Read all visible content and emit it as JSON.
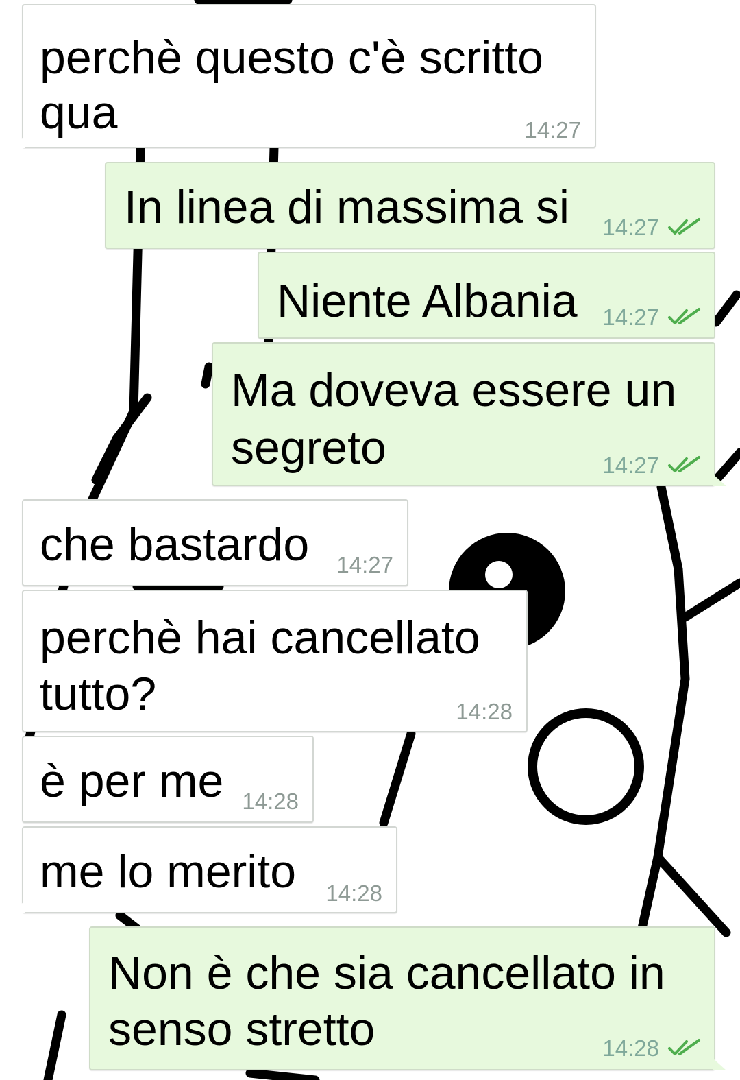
{
  "messages": [
    {
      "direction": "in",
      "lines": [
        "perchè questo c'è scritto",
        "qua"
      ],
      "time": "14:27"
    },
    {
      "direction": "out",
      "lines": [
        "In linea di massima si"
      ],
      "time": "14:27",
      "status_icon": "double-check-icon"
    },
    {
      "direction": "out",
      "lines": [
        "Niente Albania"
      ],
      "time": "14:27",
      "status_icon": "double-check-icon"
    },
    {
      "direction": "out",
      "lines": [
        "Ma doveva essere un",
        "segreto"
      ],
      "time": "14:27",
      "status_icon": "double-check-icon"
    },
    {
      "direction": "in",
      "lines": [
        "che bastardo"
      ],
      "time": "14:27"
    },
    {
      "direction": "in",
      "lines": [
        "perchè hai cancellato",
        "tutto?"
      ],
      "time": "14:28"
    },
    {
      "direction": "in",
      "lines": [
        "è per me"
      ],
      "time": "14:28"
    },
    {
      "direction": "in",
      "lines": [
        "me lo merito"
      ],
      "time": "14:28"
    },
    {
      "direction": "out",
      "lines": [
        "Non è che sia cancellato in",
        "senso stretto"
      ],
      "time": "14:28",
      "status_icon": "double-check-icon"
    }
  ],
  "colors": {
    "incoming_bubble": "#ffffff",
    "outgoing_bubble": "#e7f9dd",
    "read_ticks": "#4fae4e",
    "wallpaper_lines": "#000000"
  }
}
